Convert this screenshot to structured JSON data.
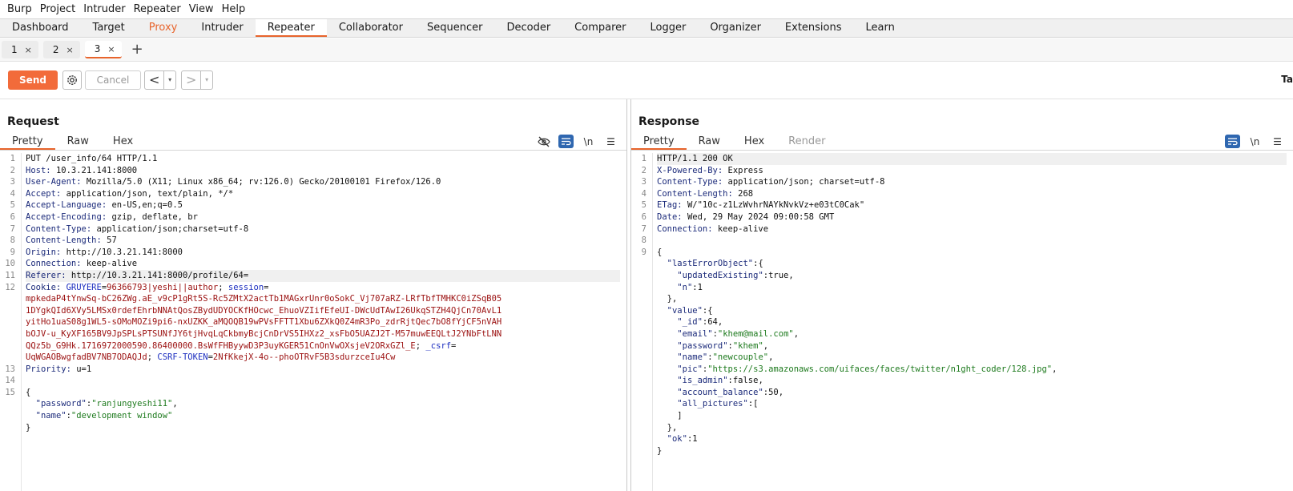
{
  "menu": [
    "Burp",
    "Project",
    "Intruder",
    "Repeater",
    "View",
    "Help"
  ],
  "tool_tabs": [
    "Dashboard",
    "Target",
    "Proxy",
    "Intruder",
    "Repeater",
    "Collaborator",
    "Sequencer",
    "Decoder",
    "Comparer",
    "Logger",
    "Organizer",
    "Extensions",
    "Learn"
  ],
  "active_tool_tab": "Repeater",
  "repeater_tabs": [
    {
      "label": "1",
      "close": "×"
    },
    {
      "label": "2",
      "close": "×"
    },
    {
      "label": "3",
      "close": "×"
    }
  ],
  "new_tab_label": "+",
  "toolbar": {
    "send": "Send",
    "cancel": "Cancel",
    "back": "<",
    "forward": ">",
    "dropdown": "▾",
    "target_cut": "Ta"
  },
  "colors": {
    "accent": "#e8642c",
    "send_button": "#f26b3a",
    "toggle_blue": "#2f67b0"
  },
  "request": {
    "title": "Request",
    "tabs": [
      "Pretty",
      "Raw",
      "Hex"
    ],
    "icons": [
      "eye-slash-icon",
      "wrap-icon",
      "newline-icon",
      "menu-icon"
    ],
    "newline_label": "\\n",
    "menu_glyph": "☰",
    "lines": [
      {
        "n": "1",
        "parts": [
          {
            "c": "hv",
            "t": "PUT /user_info/64 HTTP/1.1"
          }
        ]
      },
      {
        "n": "2",
        "parts": [
          {
            "c": "hk",
            "t": "Host: "
          },
          {
            "c": "hv",
            "t": "10.3.21.141:8000"
          }
        ]
      },
      {
        "n": "3",
        "parts": [
          {
            "c": "hk",
            "t": "User-Agent: "
          },
          {
            "c": "hv",
            "t": "Mozilla/5.0 (X11; Linux x86_64; rv:126.0) Gecko/20100101 Firefox/126.0"
          }
        ]
      },
      {
        "n": "4",
        "parts": [
          {
            "c": "hk",
            "t": "Accept: "
          },
          {
            "c": "hv",
            "t": "application/json, text/plain, */*"
          }
        ]
      },
      {
        "n": "5",
        "parts": [
          {
            "c": "hk",
            "t": "Accept-Language: "
          },
          {
            "c": "hv",
            "t": "en-US,en;q=0.5"
          }
        ]
      },
      {
        "n": "6",
        "parts": [
          {
            "c": "hk",
            "t": "Accept-Encoding: "
          },
          {
            "c": "hv",
            "t": "gzip, deflate, br"
          }
        ]
      },
      {
        "n": "7",
        "parts": [
          {
            "c": "hk",
            "t": "Content-Type: "
          },
          {
            "c": "hv",
            "t": "application/json;charset=utf-8"
          }
        ]
      },
      {
        "n": "8",
        "parts": [
          {
            "c": "hk",
            "t": "Content-Length: "
          },
          {
            "c": "hv",
            "t": "57"
          }
        ]
      },
      {
        "n": "9",
        "parts": [
          {
            "c": "hk",
            "t": "Origin: "
          },
          {
            "c": "hv",
            "t": "http://10.3.21.141:8000"
          }
        ]
      },
      {
        "n": "10",
        "parts": [
          {
            "c": "hk",
            "t": "Connection: "
          },
          {
            "c": "hv",
            "t": "keep-alive"
          }
        ]
      },
      {
        "n": "11",
        "hl": true,
        "parts": [
          {
            "c": "hk",
            "t": "Referer: "
          },
          {
            "c": "hv",
            "t": "http://10.3.21.141:8000/profile/64="
          }
        ]
      },
      {
        "n": "12",
        "parts": [
          {
            "c": "hk",
            "t": "Cookie: "
          },
          {
            "c": "ck",
            "t": "GRUYERE"
          },
          {
            "c": "hv",
            "t": "="
          },
          {
            "c": "cv",
            "t": "96366793|yeshi||author"
          },
          {
            "c": "hv",
            "t": "; "
          },
          {
            "c": "ck",
            "t": "session"
          },
          {
            "c": "hv",
            "t": "="
          }
        ]
      },
      {
        "n": "",
        "parts": [
          {
            "c": "cv",
            "t": "mpkedaP4tYnwSq-bC26ZWg.aE_v9cP1gRt5S-Rc5ZMtX2actTb1MAGxrUnr0oSokC_Vj707aRZ-LRfTbfTMHKC0iZSqB05"
          }
        ]
      },
      {
        "n": "",
        "parts": [
          {
            "c": "cv",
            "t": "1DYgkQId6XVy5LMSx0rdefEhrbNNAtQosZBydUDYOCKfHOcwc_EhuoVZIifEfeUI-DWcUdTAwI26UkqSTZH4QjCn70AvL1"
          }
        ]
      },
      {
        "n": "",
        "parts": [
          {
            "c": "cv",
            "t": "yitHo1uaS08g1WL5-sOMoMOZi9pi6-nxUZKK_aMQOQB19wPVsFFTT1Xbu6ZXkQ0Z4mR3Po_zdrRjtQec7bO8fYjCF5nVAH"
          }
        ]
      },
      {
        "n": "",
        "parts": [
          {
            "c": "cv",
            "t": "bOJV-u_KyXF165BV9JpSPLsPTSUNfJY6tjHvqLqCkbmyBcjCnDrVS5IHXz2_xsFbO5UAZJ2T-M57muwEEQLtJ2YNbFtLNN"
          }
        ]
      },
      {
        "n": "",
        "parts": [
          {
            "c": "cv",
            "t": "QQz5b_G9Hk.1716972000590.86400000.BsWfFHByywD3P3uyKGER51CnOnVwOXsjeV2ORxGZl_E"
          },
          {
            "c": "hv",
            "t": "; "
          },
          {
            "c": "ck",
            "t": "_csrf"
          },
          {
            "c": "hv",
            "t": "="
          }
        ]
      },
      {
        "n": "",
        "parts": [
          {
            "c": "cv",
            "t": "UqWGAOBwgfadBV7NB7ODAQJd"
          },
          {
            "c": "hv",
            "t": "; "
          },
          {
            "c": "ck",
            "t": "CSRF-TOKEN"
          },
          {
            "c": "hv",
            "t": "="
          },
          {
            "c": "cv",
            "t": "2NfKkejX-4o--phoOTRvF5B3sdurzceIu4Cw"
          }
        ]
      },
      {
        "n": "13",
        "parts": [
          {
            "c": "hk",
            "t": "Priority: "
          },
          {
            "c": "hv",
            "t": "u=1"
          }
        ]
      },
      {
        "n": "14",
        "parts": []
      },
      {
        "n": "15",
        "parts": [
          {
            "c": "jn",
            "t": "{"
          }
        ]
      },
      {
        "n": "",
        "parts": [
          {
            "c": "jn",
            "t": "  "
          },
          {
            "c": "jk",
            "t": "\"password\""
          },
          {
            "c": "jn",
            "t": ":"
          },
          {
            "c": "js",
            "t": "\"ranjungyeshi11\""
          },
          {
            "c": "jn",
            "t": ","
          }
        ]
      },
      {
        "n": "",
        "parts": [
          {
            "c": "jn",
            "t": "  "
          },
          {
            "c": "jk",
            "t": "\"name\""
          },
          {
            "c": "jn",
            "t": ":"
          },
          {
            "c": "js",
            "t": "\"development window\""
          }
        ]
      },
      {
        "n": "",
        "parts": [
          {
            "c": "jn",
            "t": "}"
          }
        ]
      }
    ]
  },
  "response": {
    "title": "Response",
    "tabs": [
      "Pretty",
      "Raw",
      "Hex",
      "Render"
    ],
    "icons": [
      "wrap-icon",
      "newline-icon",
      "menu-icon"
    ],
    "newline_label": "\\n",
    "menu_glyph": "☰",
    "lines": [
      {
        "n": "1",
        "hl": true,
        "parts": [
          {
            "c": "hv",
            "t": "HTTP/1.1 200 OK"
          }
        ]
      },
      {
        "n": "2",
        "parts": [
          {
            "c": "hk",
            "t": "X-Powered-By: "
          },
          {
            "c": "hv",
            "t": "Express"
          }
        ]
      },
      {
        "n": "3",
        "parts": [
          {
            "c": "hk",
            "t": "Content-Type: "
          },
          {
            "c": "hv",
            "t": "application/json; charset=utf-8"
          }
        ]
      },
      {
        "n": "4",
        "parts": [
          {
            "c": "hk",
            "t": "Content-Length: "
          },
          {
            "c": "hv",
            "t": "268"
          }
        ]
      },
      {
        "n": "5",
        "parts": [
          {
            "c": "hk",
            "t": "ETag: "
          },
          {
            "c": "hv",
            "t": "W/\"10c-z1LzWvhrNAYkNvkVz+e03tC0Cak\""
          }
        ]
      },
      {
        "n": "6",
        "parts": [
          {
            "c": "hk",
            "t": "Date: "
          },
          {
            "c": "hv",
            "t": "Wed, 29 May 2024 09:00:58 GMT"
          }
        ]
      },
      {
        "n": "7",
        "parts": [
          {
            "c": "hk",
            "t": "Connection: "
          },
          {
            "c": "hv",
            "t": "keep-alive"
          }
        ]
      },
      {
        "n": "8",
        "parts": []
      },
      {
        "n": "9",
        "parts": [
          {
            "c": "jn",
            "t": "{"
          }
        ]
      },
      {
        "n": "",
        "parts": [
          {
            "c": "jn",
            "t": "  "
          },
          {
            "c": "jk",
            "t": "\"lastErrorObject\""
          },
          {
            "c": "jn",
            "t": ":{"
          }
        ]
      },
      {
        "n": "",
        "parts": [
          {
            "c": "jn",
            "t": "    "
          },
          {
            "c": "jk",
            "t": "\"updatedExisting\""
          },
          {
            "c": "jn",
            "t": ":true,"
          }
        ]
      },
      {
        "n": "",
        "parts": [
          {
            "c": "jn",
            "t": "    "
          },
          {
            "c": "jk",
            "t": "\"n\""
          },
          {
            "c": "jn",
            "t": ":1"
          }
        ]
      },
      {
        "n": "",
        "parts": [
          {
            "c": "jn",
            "t": "  },"
          }
        ]
      },
      {
        "n": "",
        "parts": [
          {
            "c": "jn",
            "t": "  "
          },
          {
            "c": "jk",
            "t": "\"value\""
          },
          {
            "c": "jn",
            "t": ":{"
          }
        ]
      },
      {
        "n": "",
        "parts": [
          {
            "c": "jn",
            "t": "    "
          },
          {
            "c": "jk",
            "t": "\"_id\""
          },
          {
            "c": "jn",
            "t": ":64,"
          }
        ]
      },
      {
        "n": "",
        "parts": [
          {
            "c": "jn",
            "t": "    "
          },
          {
            "c": "jk",
            "t": "\"email\""
          },
          {
            "c": "jn",
            "t": ":"
          },
          {
            "c": "js",
            "t": "\"khem@mail.com\""
          },
          {
            "c": "jn",
            "t": ","
          }
        ]
      },
      {
        "n": "",
        "parts": [
          {
            "c": "jn",
            "t": "    "
          },
          {
            "c": "jk",
            "t": "\"password\""
          },
          {
            "c": "jn",
            "t": ":"
          },
          {
            "c": "js",
            "t": "\"khem\""
          },
          {
            "c": "jn",
            "t": ","
          }
        ]
      },
      {
        "n": "",
        "parts": [
          {
            "c": "jn",
            "t": "    "
          },
          {
            "c": "jk",
            "t": "\"name\""
          },
          {
            "c": "jn",
            "t": ":"
          },
          {
            "c": "js",
            "t": "\"newcouple\""
          },
          {
            "c": "jn",
            "t": ","
          }
        ]
      },
      {
        "n": "",
        "parts": [
          {
            "c": "jn",
            "t": "    "
          },
          {
            "c": "jk",
            "t": "\"pic\""
          },
          {
            "c": "jn",
            "t": ":"
          },
          {
            "c": "js",
            "t": "\"https://s3.amazonaws.com/uifaces/faces/twitter/n1ght_coder/128.jpg\""
          },
          {
            "c": "jn",
            "t": ","
          }
        ]
      },
      {
        "n": "",
        "parts": [
          {
            "c": "jn",
            "t": "    "
          },
          {
            "c": "jk",
            "t": "\"is_admin\""
          },
          {
            "c": "jn",
            "t": ":false,"
          }
        ]
      },
      {
        "n": "",
        "parts": [
          {
            "c": "jn",
            "t": "    "
          },
          {
            "c": "jk",
            "t": "\"account_balance\""
          },
          {
            "c": "jn",
            "t": ":50,"
          }
        ]
      },
      {
        "n": "",
        "parts": [
          {
            "c": "jn",
            "t": "    "
          },
          {
            "c": "jk",
            "t": "\"all_pictures\""
          },
          {
            "c": "jn",
            "t": ":["
          }
        ]
      },
      {
        "n": "",
        "parts": [
          {
            "c": "jn",
            "t": "    ]"
          }
        ]
      },
      {
        "n": "",
        "parts": [
          {
            "c": "jn",
            "t": "  },"
          }
        ]
      },
      {
        "n": "",
        "parts": [
          {
            "c": "jn",
            "t": "  "
          },
          {
            "c": "jk",
            "t": "\"ok\""
          },
          {
            "c": "jn",
            "t": ":1"
          }
        ]
      },
      {
        "n": "",
        "parts": [
          {
            "c": "jn",
            "t": "}"
          }
        ]
      }
    ]
  }
}
